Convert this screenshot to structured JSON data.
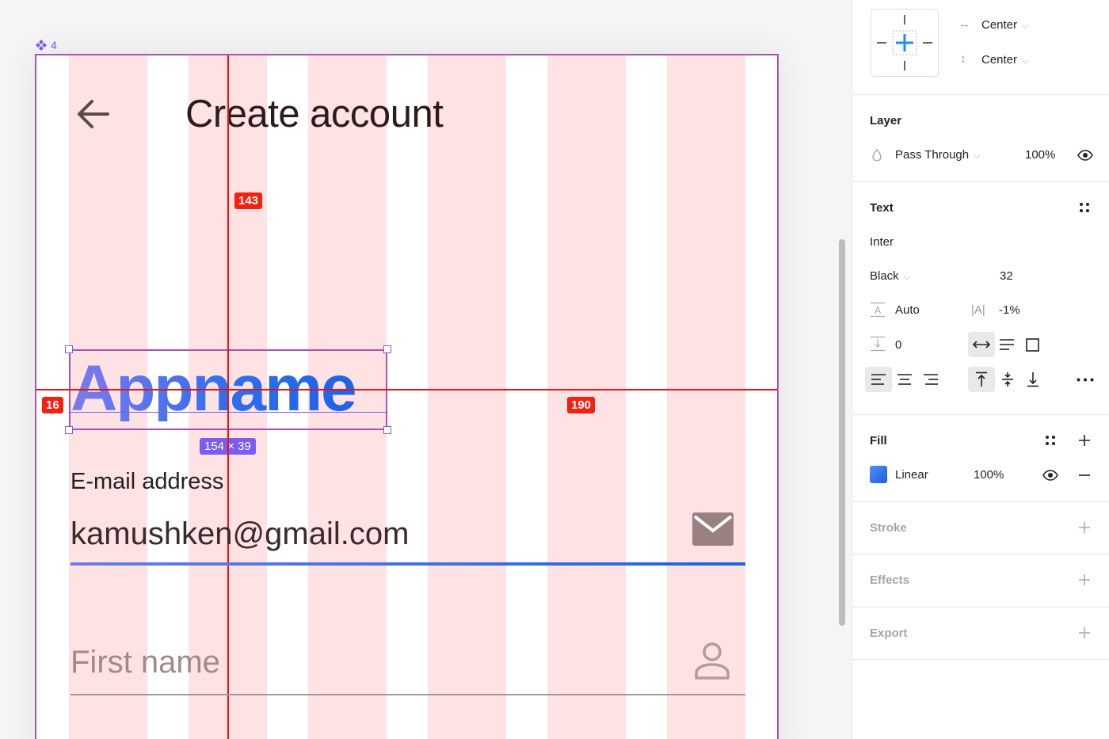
{
  "canvas": {
    "component_label": "4",
    "title": "Create account",
    "logo_text": "Appname",
    "size_badge": "154 × 39",
    "measure_top": "143",
    "measure_left": "16",
    "measure_right": "190",
    "email_label": "E-mail address",
    "email_value": "kamushken@gmail.com",
    "firstname_placeholder": "First name"
  },
  "panel": {
    "constraints": {
      "horizontal": "Center",
      "vertical": "Center"
    },
    "layer": {
      "title": "Layer",
      "blend": "Pass Through",
      "opacity": "100%"
    },
    "text": {
      "title": "Text",
      "font": "Inter",
      "weight": "Black",
      "size": "32",
      "line_height": "Auto",
      "letter_spacing": "-1%",
      "paragraph_spacing": "0"
    },
    "fill": {
      "title": "Fill",
      "type": "Linear",
      "opacity": "100%"
    },
    "stroke": {
      "title": "Stroke"
    },
    "effects": {
      "title": "Effects"
    },
    "export": {
      "title": "Export"
    }
  },
  "colors": {
    "accent_purple": "#7b5bf0",
    "guide_red": "#e11111",
    "gradient_start": "#7d7bec",
    "gradient_end": "#1c63e6"
  }
}
